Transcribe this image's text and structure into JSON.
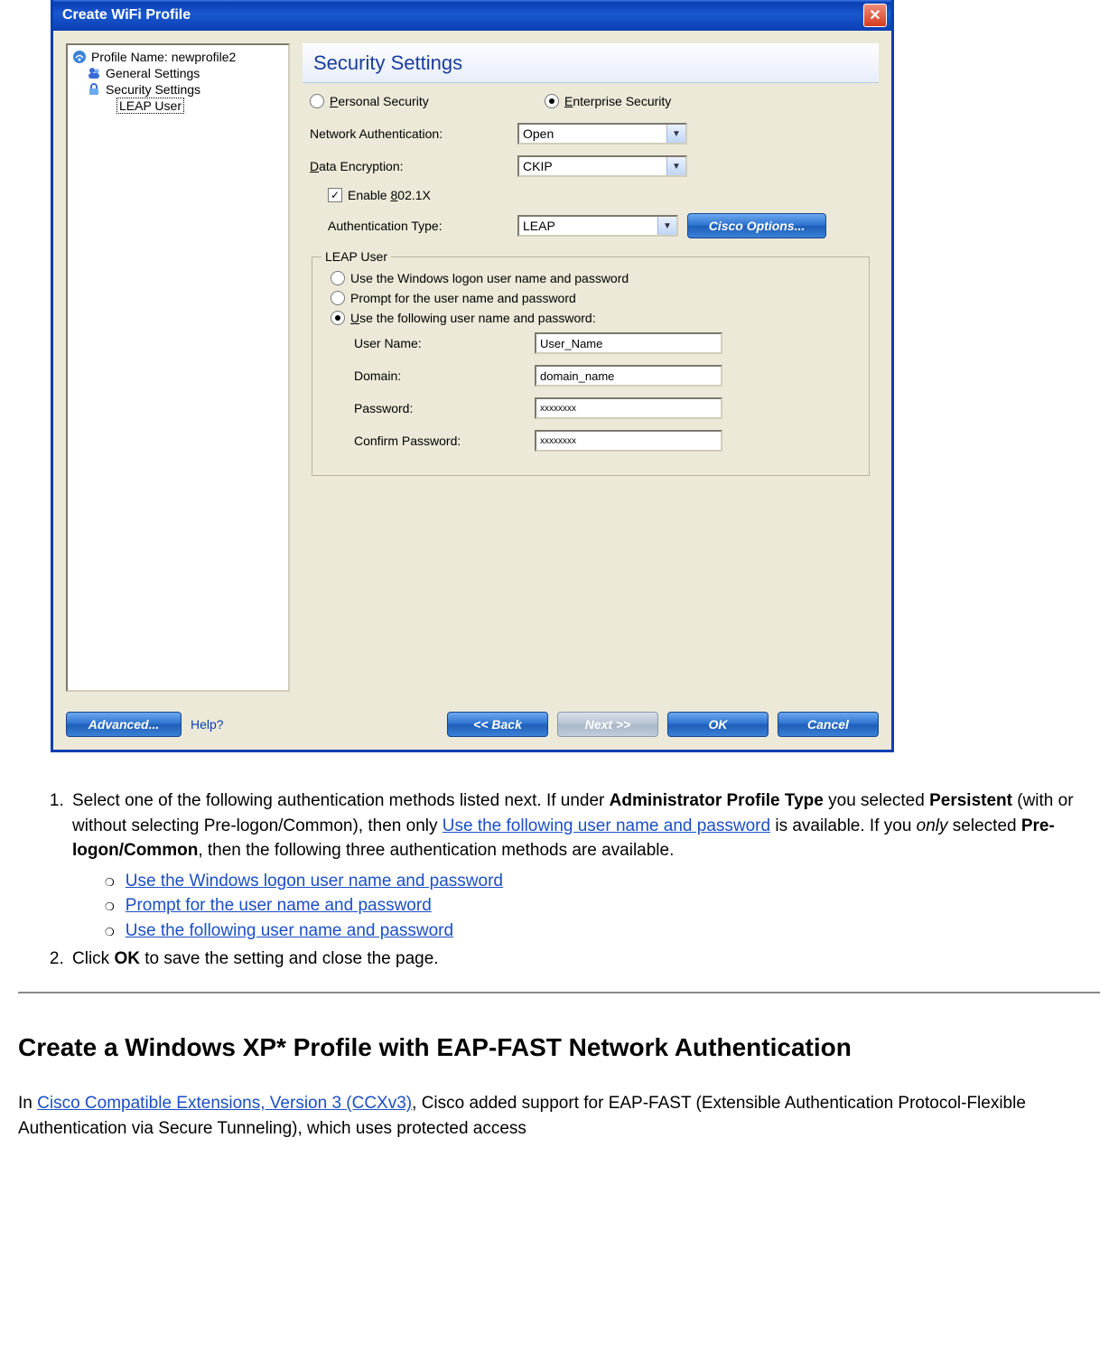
{
  "dialog": {
    "title": "Create WiFi Profile",
    "tree": {
      "profile": "Profile Name: newprofile2",
      "general": "General Settings",
      "security": "Security Settings",
      "leapuser": "LEAP User"
    },
    "header": "Security Settings",
    "radios": {
      "personal": "Personal Security",
      "enterprise": "Enterprise Security"
    },
    "fields": {
      "net_auth_label": "Network Authentication:",
      "net_auth_value": "Open",
      "data_enc_label": "Data Encryption:",
      "data_enc_value": "CKIP",
      "enable_8021x": "Enable 802.1X",
      "auth_type_label": "Authentication Type:",
      "auth_type_value": "LEAP",
      "cisco_options": "Cisco Options..."
    },
    "leap_group": {
      "legend": "LEAP User",
      "opt1": "Use the Windows logon user name and password",
      "opt2": "Prompt for the user name and password",
      "opt3": "Use the following user name and password:",
      "username_label": "User Name:",
      "username_value": "User_Name",
      "domain_label": "Domain:",
      "domain_value": "domain_name",
      "password_label": "Password:",
      "password_value": "xxxxxxxx",
      "confirm_label": "Confirm Password:",
      "confirm_value": "xxxxxxxx"
    },
    "footer": {
      "advanced": "Advanced...",
      "help": "Help?",
      "back": "<< Back",
      "next": "Next >>",
      "ok": "OK",
      "cancel": "Cancel"
    }
  },
  "doc": {
    "step1_a": "Select one of the following authentication methods listed next. If under ",
    "step1_b": "Administrator Profile Type",
    "step1_c": " you selected ",
    "step1_d": "Persistent",
    "step1_e": " (with or without selecting Pre-logon/Common), then only ",
    "step1_link1": "Use the following user name and password",
    "step1_f": " is available. If you ",
    "step1_g": "only",
    "step1_h": " selected ",
    "step1_i": "Pre-logon/Common",
    "step1_j": ", then the following three authentication methods are available.",
    "sub1": "Use the Windows logon user name and password",
    "sub2": "Prompt for the user name and password",
    "sub3": "Use the following user name and password",
    "step2_a": "Click ",
    "step2_b": "OK",
    "step2_c": " to save the setting and close the page.",
    "h2": "Create a Windows XP* Profile with EAP-FAST Network Authentication",
    "p2_a": "In ",
    "p2_link": "Cisco Compatible Extensions, Version 3 (CCXv3)",
    "p2_b": ", Cisco added support for EAP-FAST (Extensible Authentication Protocol-Flexible Authentication via Secure Tunneling), which uses protected access"
  }
}
